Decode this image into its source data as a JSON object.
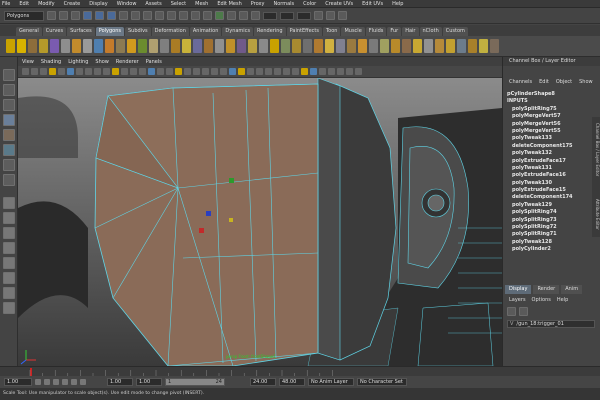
{
  "menubar": {
    "items": [
      "File",
      "Edit",
      "Modify",
      "Create",
      "Display",
      "Window",
      "Assets",
      "Select",
      "Mesh",
      "Edit Mesh",
      "Proxy",
      "Normals",
      "Color",
      "Create UVs",
      "Edit UVs",
      "Help"
    ]
  },
  "statusline": {
    "mode": "Polygons"
  },
  "shelf": {
    "tabs": [
      "General",
      "Curves",
      "Surfaces",
      "Polygons",
      "Subdivs",
      "Deformation",
      "Animation",
      "Dynamics",
      "Rendering",
      "PaintEffects",
      "Toon",
      "Muscle",
      "Fluids",
      "Fur",
      "Hair",
      "nCloth",
      "Custom"
    ],
    "active_tab": "Polygons",
    "icon_colors": [
      "#c9a200",
      "#d8b200",
      "#8d6d3b",
      "#b59a2a",
      "#7a5bb0",
      "#8e8e8e",
      "#c28b2c",
      "#9a9a9a",
      "#4f7fb0",
      "#c47b2b",
      "#8c7a52",
      "#d09a1e",
      "#6b8c2e",
      "#b0a070",
      "#7f7f7f",
      "#aa7c25",
      "#c8b23a",
      "#6a6a9a",
      "#a07030",
      "#909090",
      "#c0902a",
      "#705a8a",
      "#b8a040",
      "#8a8a8a",
      "#c9a200",
      "#7c8c5c",
      "#a88a30",
      "#6f6f6f",
      "#b07a30",
      "#d0b040",
      "#808090",
      "#9a7a40",
      "#c89030",
      "#7a7a7a",
      "#a0a060",
      "#b88a2a",
      "#8a6a4a",
      "#c8a832",
      "#929292",
      "#b58a3a",
      "#c2a030",
      "#6c7c8c",
      "#a8802a",
      "#c0b040",
      "#7a6a5a"
    ]
  },
  "viewport": {
    "menu": [
      "View",
      "Shading",
      "Lighting",
      "Show",
      "Renderer",
      "Panels"
    ],
    "label": "persp Front: frontShape1"
  },
  "channel_box": {
    "title": "Channel Box / Layer Editor",
    "menu": [
      "Channels",
      "Edit",
      "Object",
      "Show"
    ],
    "shape_name": "pCylinderShape8",
    "inputs_label": "INPUTS",
    "inputs": [
      "polySplitRing75",
      "polyMergeVert57",
      "polyMergeVert56",
      "polyMergeVert55",
      "polyTweak133",
      "deleteComponent175",
      "polyTweak132",
      "polyExtrudeFace17",
      "polyTweak131",
      "polyExtrudeFace16",
      "polyTweak130",
      "polyExtrudeFace15",
      "deleteComponent174",
      "polyTweak129",
      "polySplitRing74",
      "polySplitRing73",
      "polySplitRing72",
      "polySplitRing71",
      "polyTweak128",
      "polyCylinder2"
    ],
    "side_tabs": [
      "Channel Box / Layer Editor",
      "Attribute Editor"
    ]
  },
  "layer_editor": {
    "tabs": [
      "Display",
      "Render",
      "Anim"
    ],
    "active_tab": "Display",
    "menu": [
      "Layers",
      "Options",
      "Help"
    ],
    "layer_row": "/gun_18:trigger_01"
  },
  "time_range": {
    "start": "1.00",
    "current": "1.00",
    "current_frame": "1",
    "range_start": "1.00",
    "playback_end": "24",
    "end": "24.00",
    "anim_end": "48.00",
    "anim_layer": "No Anim Layer",
    "char_set": "No Character Set"
  },
  "help_line": "Scale Tool: Use manipulator to scale object(s). Use edit mode to change pivot (INSERT).",
  "colors": {
    "mesh_face": "#8a6b58",
    "mesh_edge": "#5fd4e6",
    "active_tab": "#6b7886"
  }
}
